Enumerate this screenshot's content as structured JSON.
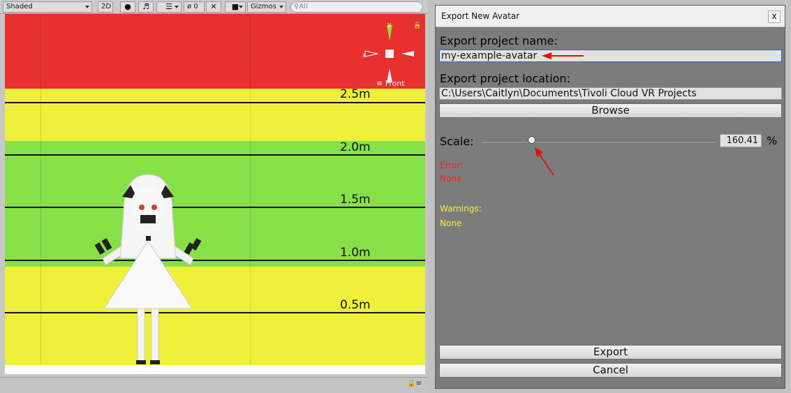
{
  "scene_toolbar": {
    "shading_mode": "Shaded",
    "toggle_2d": "2D",
    "hidden_count": "0",
    "gizmos": "Gizmos",
    "search_placeholder": "All"
  },
  "scene_view": {
    "height_markers": [
      "2.5m",
      "2.0m",
      "1.5m",
      "1.0m",
      "0.5m"
    ],
    "gizmo": {
      "y_axis": "y",
      "x_axis": "x",
      "view": "Front"
    },
    "band_colors": {
      "red": "#e83030",
      "yellow": "#eef03a",
      "green": "#88e048"
    }
  },
  "dialog": {
    "title": "Export New Avatar",
    "close": "x",
    "project_name_label": "Export project name:",
    "project_name_value": "my-example-avatar",
    "project_location_label": "Export project location:",
    "project_location_value": "C:\\Users\\Caitlyn\\Documents\\Tivoli Cloud VR Projects",
    "browse_label": "Browse",
    "scale_label": "Scale:",
    "scale_value": "160.41",
    "scale_unit": "%",
    "error_label": "Error:",
    "error_value": "None",
    "warnings_label": "Warnings:",
    "warnings_value": "None",
    "export_label": "Export",
    "cancel_label": "Cancel"
  },
  "colors": {
    "error": "#ff1e1e",
    "warning": "#f4f23a",
    "annotation_arrow": "#e01010",
    "dialog_bg": "#7c7c7c"
  }
}
